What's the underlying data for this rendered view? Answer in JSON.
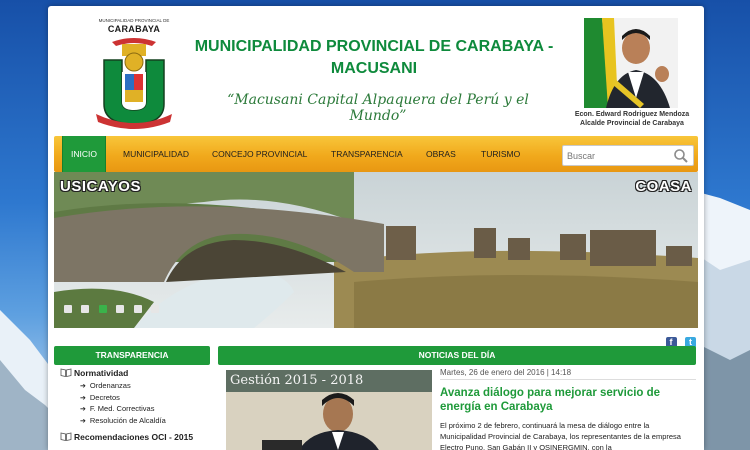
{
  "header": {
    "crest_top": "MUNICIPALIDAD PROVINCIAL DE",
    "crest_name": "CARABAYA",
    "crest_ribbon": "MACUSANI",
    "title": "MUNICIPALIDAD PROVINCIAL DE CARABAYA - MACUSANI",
    "slogan": "“Macusani Capital Alpaquera del Perú y el Mundo”",
    "mayor_name": "Econ. Edward Rodriguez Mendoza",
    "mayor_role": "Alcalde Provincial de Carabaya"
  },
  "nav": {
    "items": [
      {
        "label": "Inicio",
        "active": true
      },
      {
        "label": "Municipalidad",
        "active": false
      },
      {
        "label": "Concejo Provincial",
        "active": false
      },
      {
        "label": "Transparencia",
        "active": false
      },
      {
        "label": "Obras",
        "active": false
      },
      {
        "label": "Turismo",
        "active": false
      }
    ],
    "search_placeholder": "Buscar"
  },
  "slider": {
    "left_label": "USICAYOS",
    "right_label": "COASA",
    "slide_count": 6,
    "active_slide": 3
  },
  "social": {
    "facebook": "f",
    "twitter": "t"
  },
  "transparencia": {
    "heading": "Transparencia",
    "sections": [
      {
        "label": "Normatividad",
        "items": [
          "Ordenanzas",
          "Decretos",
          "F. Med. Correctivas",
          "Resolución de Alcaldía"
        ]
      },
      {
        "label": "Recomendaciones OCI - 2015",
        "items": []
      }
    ]
  },
  "news": {
    "heading": "Noticias del día",
    "photo_caption": "Gestión 2015 - 2018",
    "date": "Martes, 26 de enero del 2016 | 14:18",
    "title": "Avanza diálogo para mejorar servicio de energía en Carabaya",
    "body": "El próximo 2 de febrero, continuará la mesa de diálogo entre la Municipalidad Provincial de Carabaya, los representantes de la empresa Electro Puno, San Gabán II y OSINERGMIN, con la"
  },
  "colors": {
    "green": "#1f9a3a",
    "orange_nav": "#f1a91c",
    "sky": "#1e62b8"
  }
}
